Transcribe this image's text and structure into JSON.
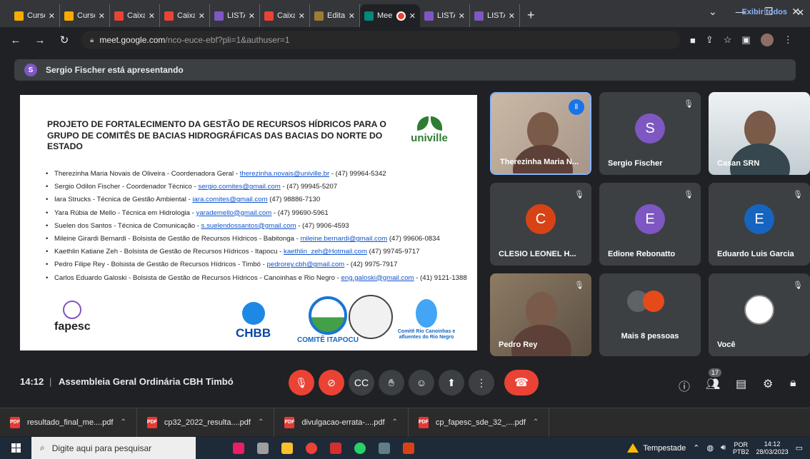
{
  "browser": {
    "tabs": [
      {
        "label": "Cursos -",
        "icon": "arrow-icon",
        "color": "#f9ab00"
      },
      {
        "label": "Cursos -",
        "icon": "arrow-icon",
        "color": "#f9ab00"
      },
      {
        "label": "Caixa de",
        "icon": "gmail-icon",
        "color": "#ea4335"
      },
      {
        "label": "Caixa de",
        "icon": "gmail-icon",
        "color": "#ea4335"
      },
      {
        "label": "LISTA PR",
        "icon": "sheets-icon",
        "color": "#7e57c2"
      },
      {
        "label": "Caixa de",
        "icon": "gmail-icon",
        "color": "#ea4335"
      },
      {
        "label": "Edital de",
        "icon": "fa-icon",
        "color": "#9e7b34"
      },
      {
        "label": "Mee",
        "icon": "meet-icon",
        "color": "#00897b",
        "active": true
      },
      {
        "label": "LISTA PR",
        "icon": "sheets-icon",
        "color": "#7e57c2"
      },
      {
        "label": "LISTA PR",
        "icon": "sheets-icon",
        "color": "#7e57c2"
      }
    ],
    "new_tab": "+",
    "url_host": "meet.google.com",
    "url_path": "/nco-euce-ebf?pli=1&authuser=1"
  },
  "banner": {
    "avatar_letter": "S",
    "text": "Sergio Fischer está apresentando"
  },
  "slide": {
    "title": "PROJETO DE FORTALECIMENTO DA GESTÃO DE RECURSOS HÍDRICOS PARA O GRUPO DE COMITÊS DE BACIAS HIDROGRÁFICAS DAS BACIAS DO NORTE DO ESTADO",
    "brand": "univille",
    "members": [
      {
        "pre": "Therezinha Maria Novais de Oliveira - Coordenadora Geral - ",
        "email": "therezinha.novais@univille.br",
        "post": " - (47) 99964-5342"
      },
      {
        "pre": "Sergio Odilon Fischer - Coordenador Técnico - ",
        "email": "sergio.comites@gmail.com",
        "post": " - (47) 99945-5207"
      },
      {
        "pre": "Iara Strucks - Técnica de Gestão Ambiental - ",
        "email": "iara.comites@gmail.com",
        "post": " (47) 98886-7130"
      },
      {
        "pre": "Yara Rúbia de Mello - Técnica em Hidrologia - ",
        "email": "yarademello@gmail.com",
        "post": " - (47) 99690-5961"
      },
      {
        "pre": "Suelen dos Santos - Técnica de Comunicação - ",
        "email": "s.suelendossantos@gmail.com",
        "post": " - (47) 9906-4593"
      },
      {
        "pre": "Mileine Girardi Bernardi - Bolsista de Gestão de Recursos Hídricos - Babitonga - ",
        "email": "mileine.bernardi@gmail.com",
        "post": " (47) 99606-0834"
      },
      {
        "pre": "Kaethlin Katiane Zeh - Bolsista de Gestão de Recursos Hídricos - Itapocu - ",
        "email": "kaethlin_zeh@Hotmail.com",
        "post": " (47) 99745-9717"
      },
      {
        "pre": "Pedro Filipe Rey - Bolsista de Gestão de Recursos Hídricos - Timbó - ",
        "email": "pedrorey.cbh@gmail.com",
        "post": " - (42) 9975-7917"
      },
      {
        "pre": "Carlos Eduardo Galoski - Bolsista de Gestão de Recursos Hídricos - Canoinhas e Rio Negro - ",
        "email": "eng.galoski@gmail.com",
        "post": " - (41) 9121-1388"
      }
    ],
    "logos": {
      "fapesc": "fapesc",
      "chbb": "CHBB",
      "itapocu": "COMITÊ ITAPOCU",
      "canoinhas": "Comitê Rio Canoinhas e afluentes do Rio Negro"
    }
  },
  "participants": [
    {
      "name": "Therezinha Maria N...",
      "type": "video",
      "speaking": true
    },
    {
      "name": "Sergio Fischer",
      "type": "avatar",
      "letter": "S",
      "color": "#7e57c2"
    },
    {
      "name": "Casan SRN",
      "type": "video"
    },
    {
      "name": "CLESIO LEONEL H...",
      "type": "avatar",
      "letter": "C",
      "color": "#d84315"
    },
    {
      "name": "Edione Rebonatto",
      "type": "avatar",
      "letter": "E",
      "color": "#7e57c2"
    },
    {
      "name": "Eduardo Luis Garcia",
      "type": "avatar",
      "letter": "E",
      "color": "#1565c0"
    },
    {
      "name": "Pedro Rey",
      "type": "video"
    },
    {
      "name": "Mais 8 pessoas",
      "type": "group"
    },
    {
      "name": "Você",
      "type": "self"
    }
  ],
  "meeting": {
    "time": "14:12",
    "separator": "|",
    "title": "Assembleia Geral Ordinária CBH Timbó",
    "people_count": "17"
  },
  "downloads": {
    "files": [
      "resultado_final_me....pdf",
      "cp32_2022_resulta....pdf",
      "divulgacao-errata-....pdf",
      "cp_fapesc_sde_32_....pdf"
    ],
    "show_all": "Exibir todos"
  },
  "taskbar": {
    "search_placeholder": "Digite aqui para pesquisar",
    "weather": "Tempestade",
    "lang_top": "POR",
    "lang_bottom": "PTB2",
    "time": "14:12",
    "date": "28/03/2023"
  }
}
